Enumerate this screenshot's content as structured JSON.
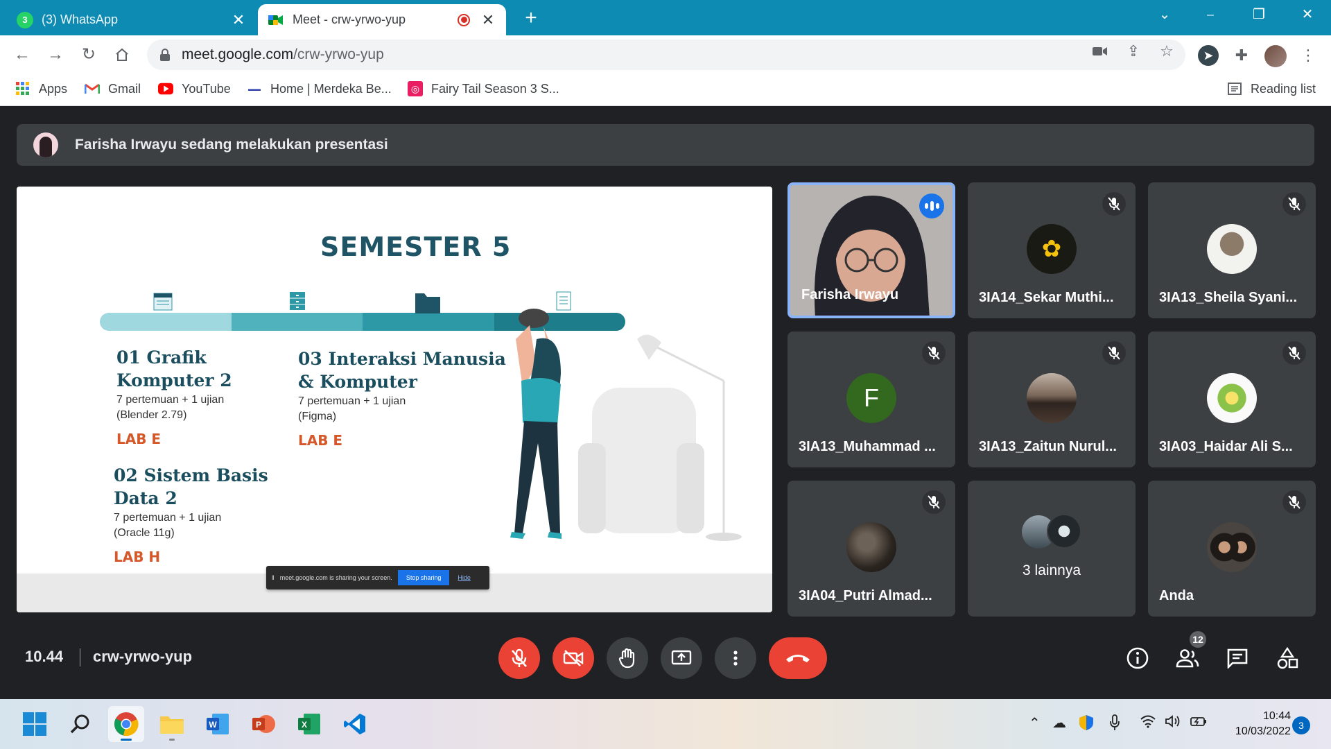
{
  "browser": {
    "tabs": [
      {
        "title": "(3) WhatsApp",
        "active": false,
        "badge": "3"
      },
      {
        "title": "Meet - crw-yrwo-yup",
        "active": true
      }
    ],
    "close_glyph": "✕",
    "new_tab_glyph": "+",
    "window_controls": {
      "minimize": "⎯",
      "restore": "❐",
      "close": "✕",
      "tab_search": "⌄"
    },
    "address": {
      "host": "meet.google.com",
      "path": "/crw-yrwo-yup"
    },
    "bookmarks": [
      "Apps",
      "Gmail",
      "YouTube",
      "Home | Merdeka Be...",
      "Fairy Tail Season 3 S..."
    ],
    "reading_list": "Reading list"
  },
  "meet": {
    "banner_text": "Farisha Irwayu sedang melakukan presentasi",
    "slide": {
      "title": "SEMESTER 5",
      "courses": [
        {
          "name_line1": "01 Grafik",
          "name_line2": "Komputer 2",
          "desc1": "7 pertemuan + 1 ujian",
          "desc2": "(Blender 2.79)",
          "lab": "LAB E"
        },
        {
          "name_line1": "03 Interaksi Manusia",
          "name_line2": "& Komputer",
          "desc1": "7 pertemuan + 1 ujian",
          "desc2": "(Figma)",
          "lab": "LAB E"
        },
        {
          "name_line1": "02 Sistem Basis",
          "name_line2": "Data 2",
          "desc1": "7 pertemuan + 1 ujian",
          "desc2": "(Oracle 11g)",
          "lab": "LAB H"
        }
      ],
      "share_notice": {
        "text": "meet.google.com is sharing your screen.",
        "stop": "Stop sharing",
        "hide": "Hide"
      }
    },
    "participants": [
      {
        "name": "Farisha Irwayu",
        "speaking": true
      },
      {
        "name": "3IA14_Sekar Muthi...",
        "muted": true
      },
      {
        "name": "3IA13_Sheila Syani...",
        "muted": true
      },
      {
        "name": "3IA13_Muhammad ...",
        "muted": true,
        "initial": "F"
      },
      {
        "name": "3IA13_Zaitun Nurul...",
        "muted": true
      },
      {
        "name": "3IA03_Haidar Ali S...",
        "muted": true
      },
      {
        "name": "3IA04_Putri Almad...",
        "muted": true
      },
      {
        "name": "3 lainnya"
      },
      {
        "name": "Anda",
        "muted": true
      }
    ],
    "time": "10.44",
    "meeting_code": "crw-yrwo-yup",
    "people_count": "12"
  },
  "taskbar": {
    "time": "10:44",
    "date": "10/03/2022",
    "notifications": "3"
  },
  "colors": {
    "accent": "#1a73e8",
    "danger": "#ea4335",
    "chrome_frame": "#0e8bb3",
    "slide_title": "#1e5466",
    "lab": "#d4582a"
  }
}
